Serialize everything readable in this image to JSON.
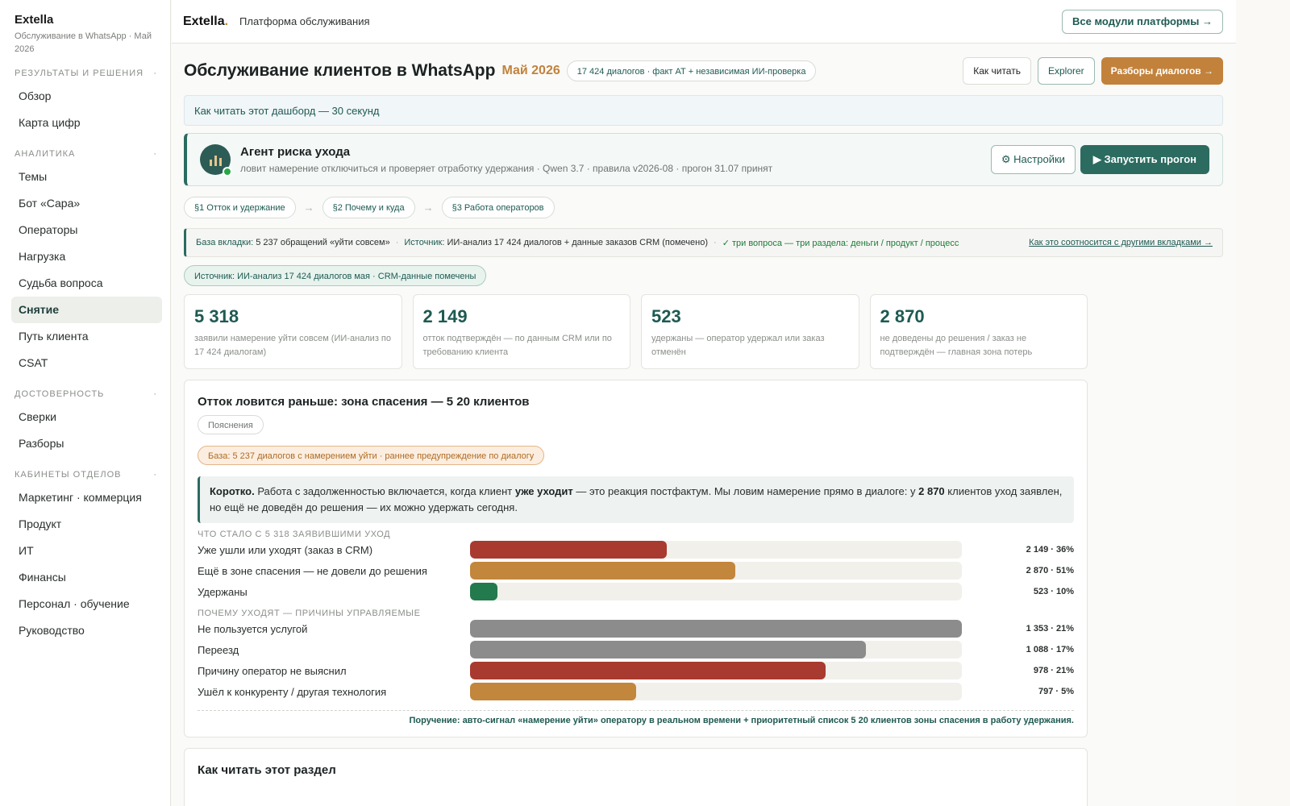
{
  "sidebar": {
    "brand": "Extella",
    "subtitle": "Обслуживание в WhatsApp · Май 2026",
    "sections": [
      {
        "title": "Результаты и решения",
        "items": [
          "Обзор",
          "Карта цифр"
        ]
      },
      {
        "title": "Аналитика",
        "items": [
          "Темы",
          "Бот «Сара»",
          "Операторы",
          "Нагрузка",
          "Судьба вопроса",
          "Снятие",
          "Путь клиента",
          "CSAT"
        ]
      },
      {
        "title": "Достоверность",
        "items": [
          "Сверки",
          "Разборы"
        ]
      },
      {
        "title": "Кабинеты отделов",
        "items": [
          "Маркетинг · коммерция",
          "Продукт",
          "ИТ",
          "Финансы",
          "Персонал · обучение",
          "Руководство"
        ]
      }
    ],
    "active_item": "Снятие",
    "collapse_marker": "·"
  },
  "topbar": {
    "logo": "Extella",
    "logo_dot": ".",
    "title": "Платформа обслуживания",
    "all_modules": "Все модули платформы →"
  },
  "header": {
    "title": "Обслуживание клиентов в WhatsApp",
    "month": "Май 2026",
    "pill": "17 424 диалогов · факт АТ + независимая ИИ-проверка",
    "btn_how": "Как читать",
    "btn_explorer": "Explorer",
    "btn_reviews": "Разборы диалогов →"
  },
  "howto": "Как читать этот дашборд — 30 секунд",
  "agent": {
    "title": "Агент риска ухода",
    "desc": "ловит намерение отключиться и проверяет отработку удержания · Qwen 3.7 · правила v2026-08 · прогон 31.07 принят",
    "settings": "⚙ Настройки",
    "run": "▶ Запустить прогон"
  },
  "steps": [
    "§1 Отток и удержание",
    "§2 Почему и куда",
    "§3 Работа операторов"
  ],
  "step_arrow": "→",
  "base_row": {
    "base_label": "База вкладки:",
    "base_value": "5 237 обращений «уйти совсем»",
    "source_label": "Источник:",
    "source_value": "ИИ-анализ 17 424 диалогов + данные заказов CRM (помечено)",
    "check": "✓ три вопроса — три раздела: деньги / продукт / процесс",
    "link": "Как это соотносится с другими вкладками →",
    "sep": "·"
  },
  "source_pill": "Источник: ИИ-анализ 17 424 диалогов мая · CRM-данные помечены",
  "kpis": [
    {
      "value": "5 318",
      "label": "заявили намерение уйти совсем (ИИ-анализ по 17 424 диалогам)"
    },
    {
      "value": "2 149",
      "label": "отток подтверждён — по данным CRM или по требованию клиента"
    },
    {
      "value": "523",
      "label": "удержаны — оператор удержал или заказ отменён"
    },
    {
      "value": "2 870",
      "label": "не доведены до решения / заказ не подтверждён — главная зона потерь"
    }
  ],
  "card": {
    "title": "Отток ловится раньше: зона спасения — 5 20 клиентов",
    "explain_btn": "Пояснения",
    "warn": "База: 5 237 диалогов с намерением уйти · раннее предупреждение по диалогу",
    "short_prefix": "Коротко.",
    "short_1": " Работа с задолженностью включается, когда клиент ",
    "short_bold1": "уже уходит",
    "short_2": " — это реакция постфактум. Мы ловим намерение прямо в диалоге: у ",
    "short_bold2": "2 870",
    "short_3": " клиентов уход заявлен, но ещё не доведён до решения — их можно удержать сегодня.",
    "group1_title": "Что стало с 5 318 заявившими уход",
    "group1": [
      {
        "label": "Уже ушли или уходят (заказ в CRM)",
        "value_text": "2 149 · 36%",
        "fill": 0.4,
        "color": "#a83a30"
      },
      {
        "label": "Ещё в зоне спасения — не довели до решения",
        "value_text": "2 870 · 51%",
        "fill": 0.54,
        "color": "#c2863c"
      },
      {
        "label": "Удержаны",
        "value_text": "523 · 10%",
        "fill": 0.055,
        "color": "#237a4c"
      }
    ],
    "group2_title": "Почему уходят — причины управляемые",
    "group2": [
      {
        "label": "Не пользуется услугой",
        "value_text": "1 353 · 21%",
        "fill": 1.0,
        "color": "#8c8c8c"
      },
      {
        "label": "Переезд",
        "value_text": "1 088 · 17%",
        "fill": 0.805,
        "color": "#8c8c8c"
      },
      {
        "label": "Причину оператор не выяснил",
        "value_text": "978 · 21%",
        "fill": 0.723,
        "color": "#a83a30"
      },
      {
        "label": "Ушёл к конкуренту / другая технология",
        "value_text": "797 · 5%",
        "fill": 0.337,
        "color": "#c2863c"
      }
    ],
    "order": "Поручение: авто-сигнал «намерение уйти» оператору в реальном времени + приоритетный список 5 20 клиентов зоны спасения в работу удержания."
  },
  "card2_title": "Как читать этот раздел"
}
